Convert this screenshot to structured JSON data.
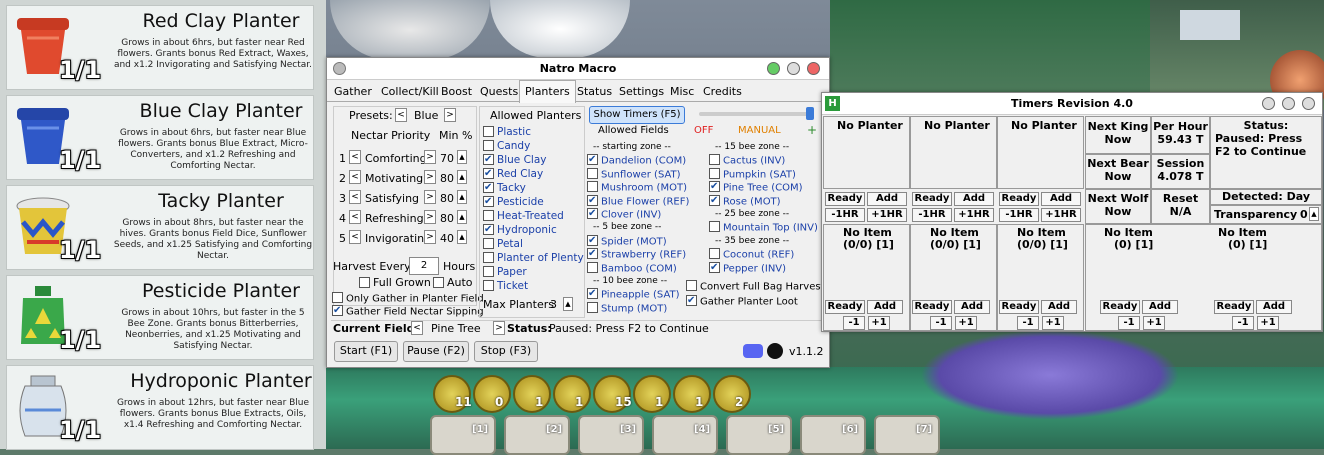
{
  "planters": [
    {
      "name": "Red Clay Planter",
      "desc": "Grows in about 6hrs, but faster near Red flowers. Grants bonus Red Extract, Waxes, and x1.2 Invigorating and Satisfying Nectar.",
      "count": "1/1",
      "color": "#d8432a"
    },
    {
      "name": "Blue Clay Planter",
      "desc": "Grows in about 6hrs, but faster near Blue flowers. Grants bonus Blue Extract, Micro-Converters, and x1.2 Refreshing and Comforting Nectar.",
      "count": "1/1",
      "color": "#2f58c8"
    },
    {
      "name": "Tacky Planter",
      "desc": "Grows in about 8hrs, but faster near the hives. Grants bonus Field Dice, Sunflower Seeds, and x1.25 Satisfying and Comforting Nectar.",
      "count": "1/1",
      "color": "#e3c53a"
    },
    {
      "name": "Pesticide Planter",
      "desc": "Grows in about 10hrs, but faster in the 5 Bee Zone. Grants bonus Bitterberries, Neonberries, and x1.25 Motivating and Satisfying Nectar.",
      "count": "1/1",
      "color": "#3aa84a"
    },
    {
      "name": "Hydroponic Planter",
      "desc": "Grows in about 12hrs, but faster near Blue flowers. Grants bonus Blue Extracts, Oils, x1.4 Refreshing and Comforting Nectar.",
      "count": "1/1",
      "color": "#c8d6e4"
    }
  ],
  "macro": {
    "title": "Natro Macro",
    "tabs": [
      "Gather",
      "Collect/Kill",
      "Boost",
      "Quests",
      "Planters",
      "Status",
      "Settings",
      "Misc",
      "Credits"
    ],
    "active_tab": "Planters",
    "presets_label": "Presets:",
    "preset_value": "Blue",
    "nectar_priority_label": "Nectar Priority",
    "min_pct_label": "Min %",
    "nectars": [
      {
        "n": "1",
        "name": "Comforting",
        "min": "70"
      },
      {
        "n": "2",
        "name": "Motivating",
        "min": "80"
      },
      {
        "n": "3",
        "name": "Satisfying",
        "min": "80"
      },
      {
        "n": "4",
        "name": "Refreshing",
        "min": "80"
      },
      {
        "n": "5",
        "name": "Invigorating",
        "min": "40"
      }
    ],
    "harvest_every_label": "Harvest Every",
    "harvest_value": "2",
    "hours_label": "Hours",
    "full_grown_label": "Full Grown",
    "auto_label": "Auto",
    "only_gather_label": "Only Gather in Planter Field",
    "gather_sipping_label": "Gather Field Nectar Sipping",
    "allowed_planters_label": "Allowed Planters",
    "allowed_planters": [
      {
        "name": "Plastic",
        "on": false
      },
      {
        "name": "Candy",
        "on": false
      },
      {
        "name": "Blue Clay",
        "on": true
      },
      {
        "name": "Red Clay",
        "on": true
      },
      {
        "name": "Tacky",
        "on": true
      },
      {
        "name": "Pesticide",
        "on": true
      },
      {
        "name": "Heat-Treated",
        "on": false
      },
      {
        "name": "Hydroponic",
        "on": true
      },
      {
        "name": "Petal",
        "on": false
      },
      {
        "name": "Planter of Plenty",
        "on": false
      },
      {
        "name": "Paper",
        "on": false
      },
      {
        "name": "Ticket",
        "on": false
      }
    ],
    "max_planters_label": "Max Planters",
    "max_planters_value": "3",
    "show_timers_label": "Show Timers (F5)",
    "allowed_fields_label": "Allowed Fields",
    "off_label": "OFF",
    "manual_label": "MANUAL",
    "plus_label": "+",
    "fields_left": [
      {
        "type": "header",
        "text": "-- starting zone --"
      },
      {
        "name": "Dandelion (COM)",
        "on": true
      },
      {
        "name": "Sunflower (SAT)",
        "on": false
      },
      {
        "name": "Mushroom (MOT)",
        "on": false
      },
      {
        "name": "Blue Flower (REF)",
        "on": true
      },
      {
        "name": "Clover (INV)",
        "on": true
      },
      {
        "type": "header",
        "text": "-- 5 bee zone --"
      },
      {
        "name": "Spider (MOT)",
        "on": true
      },
      {
        "name": "Strawberry (REF)",
        "on": true
      },
      {
        "name": "Bamboo (COM)",
        "on": false
      },
      {
        "type": "header",
        "text": "-- 10 bee zone --"
      },
      {
        "name": "Pineapple (SAT)",
        "on": true
      },
      {
        "name": "Stump (MOT)",
        "on": false
      }
    ],
    "fields_right": [
      {
        "type": "header",
        "text": "-- 15 bee zone --"
      },
      {
        "name": "Cactus (INV)",
        "on": false
      },
      {
        "name": "Pumpkin (SAT)",
        "on": false
      },
      {
        "name": "Pine Tree (COM)",
        "on": true
      },
      {
        "name": "Rose (MOT)",
        "on": true
      },
      {
        "type": "header",
        "text": "-- 25 bee zone --"
      },
      {
        "name": "Mountain Top (INV)",
        "on": false
      },
      {
        "type": "header",
        "text": "-- 35 bee zone --"
      },
      {
        "name": "Coconut (REF)",
        "on": false
      },
      {
        "name": "Pepper (INV)",
        "on": true
      }
    ],
    "convert_label": "Convert Full Bag Harvest",
    "gather_loot_label": "Gather Planter Loot",
    "current_field_label": "Current Field:",
    "current_field": "Pine Tree",
    "status_label": "Status:",
    "status_value": "Paused: Press F2 to Continue",
    "start_label": "Start (F1)",
    "pause_label": "Pause (F2)",
    "stop_label": "Stop (F3)",
    "version": "v1.1.2"
  },
  "timers": {
    "title": "Timers Revision 4.0",
    "slots": [
      {
        "name": "No Planter",
        "item": "No Item",
        "ratio": "(0/0) [1]"
      },
      {
        "name": "No Planter",
        "item": "No Item",
        "ratio": "(0/0) [1]"
      },
      {
        "name": "No Planter",
        "item": "No Item",
        "ratio": "(0/0) [1]"
      }
    ],
    "extra_items": [
      {
        "item": "No Item",
        "ratio": "(0) [1]"
      },
      {
        "item": "No Item",
        "ratio": "(0) [1]"
      }
    ],
    "ready_label": "Ready",
    "add_label": "Add",
    "m1hr": "-1HR",
    "p1hr": "+1HR",
    "m1": "-1",
    "p1": "+1",
    "next_king_label": "Next King",
    "next_king_value": "Now",
    "next_bear_label": "Next Bear",
    "next_bear_value": "Now",
    "next_wolf_label": "Next Wolf",
    "next_wolf_value": "Now",
    "per_hour_label": "Per Hour",
    "per_hour_value": "59.43 T",
    "session_label": "Session",
    "session_value": "4.078 T",
    "reset_label": "Reset",
    "reset_value": "N/A",
    "status_label": "Status:",
    "status_value": "Paused: Press F2 to Continue",
    "detected_label": "Detected: Day",
    "transparency_label": "Transparency",
    "transparency_value": "0"
  },
  "hotbar": {
    "counts": [
      "11",
      "0",
      "1",
      "1",
      "15",
      "1",
      "1",
      "2"
    ],
    "slots": [
      "[1]",
      "[2]",
      "[3]",
      "[4]",
      "[5]",
      "[6]",
      "[7]"
    ]
  }
}
